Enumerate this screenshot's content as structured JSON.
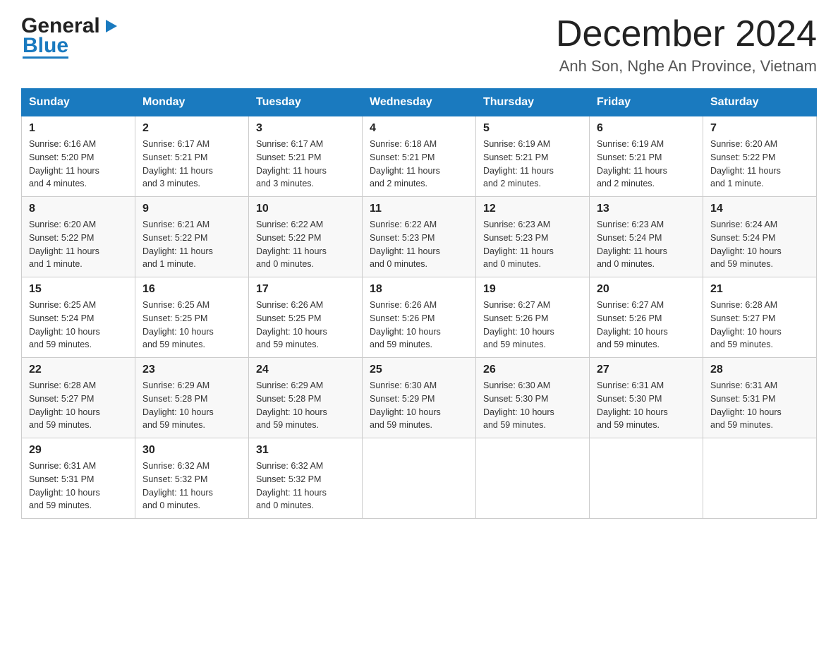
{
  "header": {
    "logo_general": "General",
    "logo_blue": "Blue",
    "month_title": "December 2024",
    "location": "Anh Son, Nghe An Province, Vietnam"
  },
  "days_of_week": [
    "Sunday",
    "Monday",
    "Tuesday",
    "Wednesday",
    "Thursday",
    "Friday",
    "Saturday"
  ],
  "weeks": [
    [
      {
        "day": "1",
        "sunrise": "6:16 AM",
        "sunset": "5:20 PM",
        "daylight": "11 hours and 4 minutes."
      },
      {
        "day": "2",
        "sunrise": "6:17 AM",
        "sunset": "5:21 PM",
        "daylight": "11 hours and 3 minutes."
      },
      {
        "day": "3",
        "sunrise": "6:17 AM",
        "sunset": "5:21 PM",
        "daylight": "11 hours and 3 minutes."
      },
      {
        "day": "4",
        "sunrise": "6:18 AM",
        "sunset": "5:21 PM",
        "daylight": "11 hours and 2 minutes."
      },
      {
        "day": "5",
        "sunrise": "6:19 AM",
        "sunset": "5:21 PM",
        "daylight": "11 hours and 2 minutes."
      },
      {
        "day": "6",
        "sunrise": "6:19 AM",
        "sunset": "5:21 PM",
        "daylight": "11 hours and 2 minutes."
      },
      {
        "day": "7",
        "sunrise": "6:20 AM",
        "sunset": "5:22 PM",
        "daylight": "11 hours and 1 minute."
      }
    ],
    [
      {
        "day": "8",
        "sunrise": "6:20 AM",
        "sunset": "5:22 PM",
        "daylight": "11 hours and 1 minute."
      },
      {
        "day": "9",
        "sunrise": "6:21 AM",
        "sunset": "5:22 PM",
        "daylight": "11 hours and 1 minute."
      },
      {
        "day": "10",
        "sunrise": "6:22 AM",
        "sunset": "5:22 PM",
        "daylight": "11 hours and 0 minutes."
      },
      {
        "day": "11",
        "sunrise": "6:22 AM",
        "sunset": "5:23 PM",
        "daylight": "11 hours and 0 minutes."
      },
      {
        "day": "12",
        "sunrise": "6:23 AM",
        "sunset": "5:23 PM",
        "daylight": "11 hours and 0 minutes."
      },
      {
        "day": "13",
        "sunrise": "6:23 AM",
        "sunset": "5:24 PM",
        "daylight": "11 hours and 0 minutes."
      },
      {
        "day": "14",
        "sunrise": "6:24 AM",
        "sunset": "5:24 PM",
        "daylight": "10 hours and 59 minutes."
      }
    ],
    [
      {
        "day": "15",
        "sunrise": "6:25 AM",
        "sunset": "5:24 PM",
        "daylight": "10 hours and 59 minutes."
      },
      {
        "day": "16",
        "sunrise": "6:25 AM",
        "sunset": "5:25 PM",
        "daylight": "10 hours and 59 minutes."
      },
      {
        "day": "17",
        "sunrise": "6:26 AM",
        "sunset": "5:25 PM",
        "daylight": "10 hours and 59 minutes."
      },
      {
        "day": "18",
        "sunrise": "6:26 AM",
        "sunset": "5:26 PM",
        "daylight": "10 hours and 59 minutes."
      },
      {
        "day": "19",
        "sunrise": "6:27 AM",
        "sunset": "5:26 PM",
        "daylight": "10 hours and 59 minutes."
      },
      {
        "day": "20",
        "sunrise": "6:27 AM",
        "sunset": "5:26 PM",
        "daylight": "10 hours and 59 minutes."
      },
      {
        "day": "21",
        "sunrise": "6:28 AM",
        "sunset": "5:27 PM",
        "daylight": "10 hours and 59 minutes."
      }
    ],
    [
      {
        "day": "22",
        "sunrise": "6:28 AM",
        "sunset": "5:27 PM",
        "daylight": "10 hours and 59 minutes."
      },
      {
        "day": "23",
        "sunrise": "6:29 AM",
        "sunset": "5:28 PM",
        "daylight": "10 hours and 59 minutes."
      },
      {
        "day": "24",
        "sunrise": "6:29 AM",
        "sunset": "5:28 PM",
        "daylight": "10 hours and 59 minutes."
      },
      {
        "day": "25",
        "sunrise": "6:30 AM",
        "sunset": "5:29 PM",
        "daylight": "10 hours and 59 minutes."
      },
      {
        "day": "26",
        "sunrise": "6:30 AM",
        "sunset": "5:30 PM",
        "daylight": "10 hours and 59 minutes."
      },
      {
        "day": "27",
        "sunrise": "6:31 AM",
        "sunset": "5:30 PM",
        "daylight": "10 hours and 59 minutes."
      },
      {
        "day": "28",
        "sunrise": "6:31 AM",
        "sunset": "5:31 PM",
        "daylight": "10 hours and 59 minutes."
      }
    ],
    [
      {
        "day": "29",
        "sunrise": "6:31 AM",
        "sunset": "5:31 PM",
        "daylight": "10 hours and 59 minutes."
      },
      {
        "day": "30",
        "sunrise": "6:32 AM",
        "sunset": "5:32 PM",
        "daylight": "11 hours and 0 minutes."
      },
      {
        "day": "31",
        "sunrise": "6:32 AM",
        "sunset": "5:32 PM",
        "daylight": "11 hours and 0 minutes."
      },
      null,
      null,
      null,
      null
    ]
  ],
  "labels": {
    "sunrise": "Sunrise:",
    "sunset": "Sunset:",
    "daylight": "Daylight:"
  }
}
